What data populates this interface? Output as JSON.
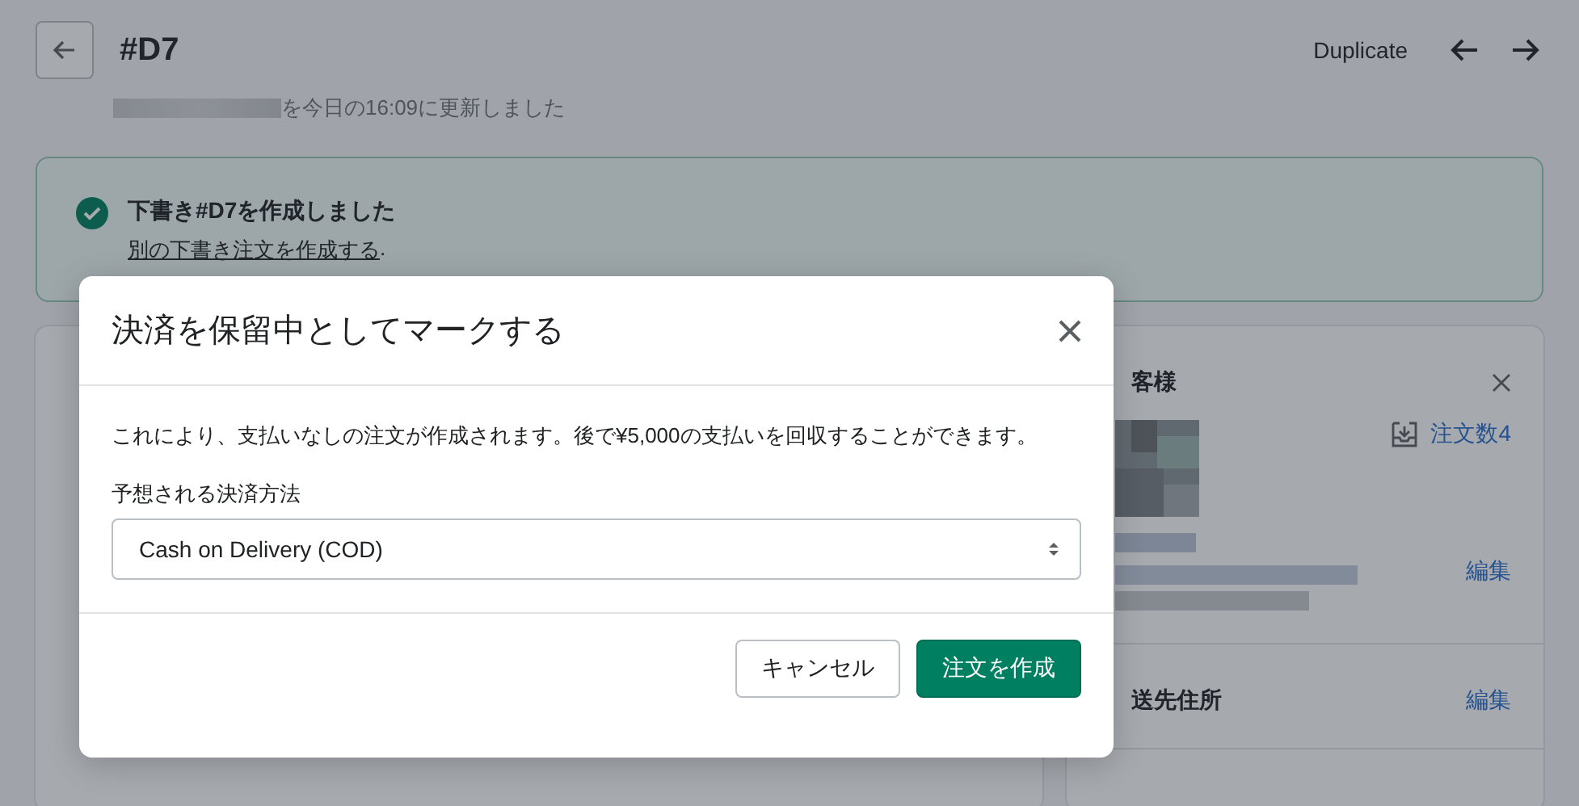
{
  "header": {
    "title": "#D7",
    "duplicate": "Duplicate",
    "subtitle": "を今日の16:09に更新しました"
  },
  "banner": {
    "title": "下書き#D7を作成しました",
    "link": "別の下書き注文を作成する",
    "trail": "."
  },
  "customer": {
    "heading": "客様",
    "orders": "注文数4",
    "edit": "編集",
    "shipping_heading": "送先住所",
    "shipping_edit": "編集"
  },
  "modal": {
    "title": "決済を保留中としてマークする",
    "body": "これにより、支払いなしの注文が作成されます。後で¥5,000の支払いを回収することができます。",
    "field_label": "予想される決済方法",
    "select_value": "Cash on Delivery (COD)",
    "buttons": [
      {
        "label": "キャンセル",
        "kind": "secondary"
      },
      {
        "label": "注文を作成",
        "kind": "primary"
      }
    ]
  }
}
